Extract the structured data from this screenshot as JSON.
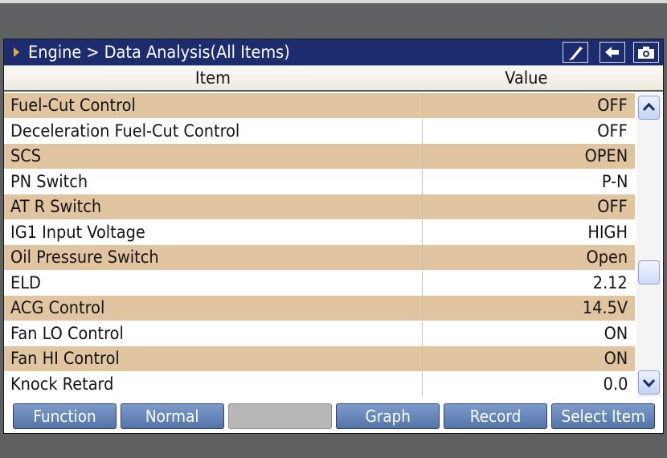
{
  "titlebar": {
    "breadcrumb": "Engine > Data Analysis(All Items)",
    "icons": [
      "pen-icon",
      "back-arrow-icon",
      "camera-icon"
    ]
  },
  "table": {
    "headers": {
      "item": "Item",
      "value": "Value"
    },
    "rows": [
      {
        "name": "Fuel-Cut Control",
        "value": "OFF"
      },
      {
        "name": "Deceleration Fuel-Cut Control",
        "value": "OFF"
      },
      {
        "name": "SCS",
        "value": "OPEN"
      },
      {
        "name": "PN Switch",
        "value": "P-N"
      },
      {
        "name": "AT R Switch",
        "value": "OFF"
      },
      {
        "name": "IG1 Input Voltage",
        "value": "HIGH"
      },
      {
        "name": "Oil Pressure Switch",
        "value": "Open"
      },
      {
        "name": "ELD",
        "value": "2.12"
      },
      {
        "name": "ACG Control",
        "value": "14.5V"
      },
      {
        "name": "Fan LO Control",
        "value": "ON"
      },
      {
        "name": "Fan HI Control",
        "value": "ON"
      },
      {
        "name": "Knock Retard",
        "value": "0.0"
      }
    ]
  },
  "toolbar": {
    "function_label": "Function",
    "normal_label": "Normal",
    "blank_label": "",
    "graph_label": "Graph",
    "record_label": "Record",
    "select_item_label": "Select Item"
  },
  "colors": {
    "titlebar": "#1d2c6e",
    "row_alt": "#e1c5a0",
    "button": "#6585bb",
    "accent_arrow": "#f0a53a"
  }
}
